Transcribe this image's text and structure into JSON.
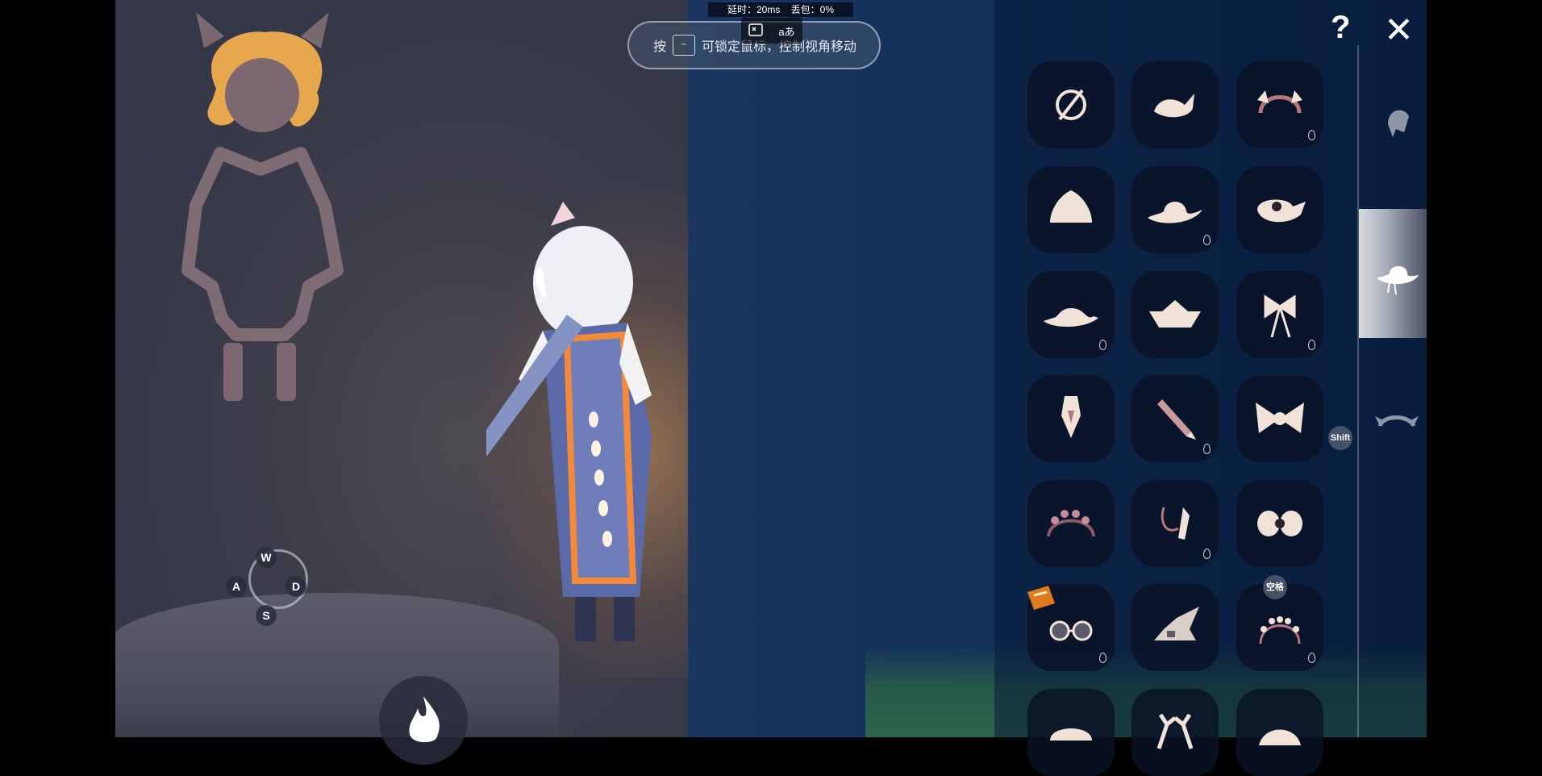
{
  "hud": {
    "latency": "延时：20ms",
    "packet_loss": "丢包：0%",
    "hint_prefix": "按",
    "hint_key": "~",
    "hint_suffix": "可锁定鼠标，控制视角移动",
    "translate_glyph": "aあ"
  },
  "movement_keys": {
    "up": "W",
    "left": "A",
    "right": "D",
    "down": "S"
  },
  "panel": {
    "help_glyph": "?",
    "close_glyph": "✕",
    "shift_label": "Shift",
    "space_label": "空格",
    "items": [
      {
        "icon": "none-icon",
        "owned_drop": false
      },
      {
        "icon": "bird-hat-icon",
        "owned_drop": false
      },
      {
        "icon": "wing-headband-icon",
        "owned_drop": true
      },
      {
        "icon": "bun-hat-icon",
        "owned_drop": false
      },
      {
        "icon": "cowboy-hat-icon",
        "owned_drop": true
      },
      {
        "icon": "pipe-hat-icon",
        "owned_drop": false
      },
      {
        "icon": "bowler-hat-icon",
        "owned_drop": true
      },
      {
        "icon": "paper-boat-hat-icon",
        "owned_drop": false
      },
      {
        "icon": "ribbon-bow-icon",
        "owned_drop": true
      },
      {
        "icon": "crystal-pin-icon",
        "owned_drop": false
      },
      {
        "icon": "pencil-pin-icon",
        "owned_drop": true
      },
      {
        "icon": "big-bow-icon",
        "owned_drop": false
      },
      {
        "icon": "flower-crown-icon",
        "owned_drop": false
      },
      {
        "icon": "tassel-pin-icon",
        "owned_drop": true
      },
      {
        "icon": "small-bow-icon",
        "owned_drop": false
      },
      {
        "icon": "goggles-icon",
        "owned_drop": true
      },
      {
        "icon": "witch-hat-icon",
        "owned_drop": false
      },
      {
        "icon": "pearl-headband-icon",
        "owned_drop": true
      },
      {
        "icon": "mushroom-hat-icon",
        "owned_drop": false
      },
      {
        "icon": "antler-icon",
        "owned_drop": false
      },
      {
        "icon": "star-hat-icon",
        "owned_drop": false
      }
    ],
    "categories": [
      "hair-icon",
      "hat-icon",
      "horn-icon"
    ],
    "active_category": 1
  }
}
